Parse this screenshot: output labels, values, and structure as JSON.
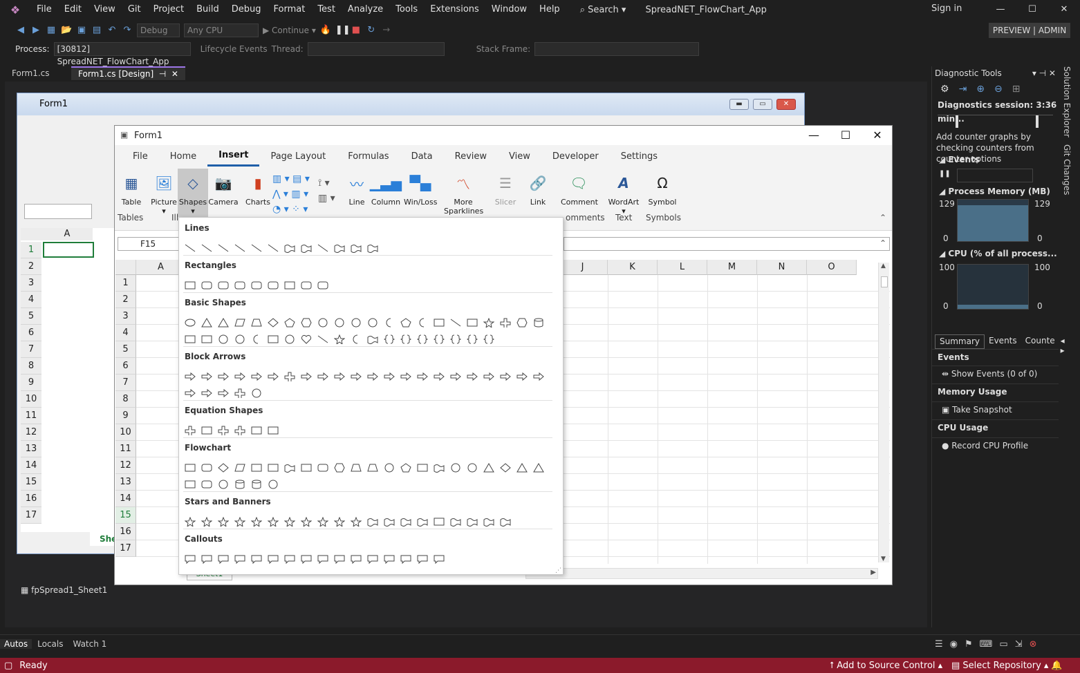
{
  "menubar": {
    "items": [
      "File",
      "Edit",
      "View",
      "Git",
      "Project",
      "Build",
      "Debug",
      "Format",
      "Test",
      "Analyze",
      "Tools",
      "Extensions",
      "Window",
      "Help"
    ],
    "search": "Search",
    "app_title": "SpreadNET_FlowChart_App",
    "sign_in": "Sign in"
  },
  "toolbar": {
    "config": "Debug",
    "platform": "Any CPU",
    "continue": "Continue",
    "preview": "PREVIEW | ADMIN"
  },
  "debugbar": {
    "process_label": "Process:",
    "process_value": "[30812] SpreadNET_FlowChart_App",
    "lifecycle": "Lifecycle Events",
    "thread_label": "Thread:",
    "stack_label": "Stack Frame:"
  },
  "doc_tabs": [
    {
      "label": "Form1.cs"
    },
    {
      "label": "Form1.cs [Design]"
    }
  ],
  "bg_form": {
    "title": "Form1",
    "col_a": "A",
    "rows": [
      "1",
      "2",
      "3",
      "4",
      "5",
      "6",
      "7",
      "8",
      "9",
      "10",
      "11",
      "12",
      "13",
      "14",
      "15",
      "16",
      "17"
    ],
    "sheet_tab": "She"
  },
  "fg_form": {
    "title": "Form1",
    "ribbon_tabs": [
      "File",
      "Home",
      "Insert",
      "Page Layout",
      "Formulas",
      "Data",
      "Review",
      "View",
      "Developer",
      "Settings"
    ],
    "active_tab": "Insert",
    "buttons": {
      "table": "Table",
      "picture": "Picture",
      "shapes": "Shapes",
      "camera": "Camera",
      "charts": "Charts",
      "line": "Line",
      "column": "Column",
      "winloss": "Win/Loss",
      "more": "More",
      "sparklines": "Sparklines",
      "slicer": "Slicer",
      "link": "Link",
      "comment": "Comment",
      "wordart": "WordArt",
      "symbol": "Symbol"
    },
    "groups": {
      "tables": "Tables",
      "ill": "Ill",
      "comments": "omments",
      "text": "Text",
      "symbols": "Symbols"
    },
    "namebox": "F15",
    "columns_left": [
      "A"
    ],
    "columns_right": [
      "J",
      "K",
      "L",
      "M",
      "N",
      "O"
    ],
    "rows": [
      "1",
      "2",
      "3",
      "4",
      "5",
      "6",
      "7",
      "8",
      "9",
      "10",
      "11",
      "12",
      "13",
      "14",
      "15",
      "16",
      "17"
    ],
    "selected_row": "15",
    "sheet_tab": "Sheet1"
  },
  "shapes_gallery": {
    "sections": [
      "Lines",
      "Rectangles",
      "Basic Shapes",
      "Block Arrows",
      "Equation Shapes",
      "Flowchart",
      "Stars and Banners",
      "Callouts"
    ]
  },
  "component_tray": {
    "item": "fpSpread1_Sheet1"
  },
  "diagnostics": {
    "title": "Diagnostic Tools",
    "session": "Diagnostics session: 3:36 min...",
    "hint": "Add counter graphs by checking counters from counter options",
    "events_header": "Events",
    "memory_header": "Process Memory (MB)",
    "mem_max": "129",
    "mem_min": "0",
    "cpu_header": "CPU (% of all process...",
    "cpu_max": "100",
    "cpu_min": "0",
    "tabs": [
      "Summary",
      "Events",
      "Counte"
    ],
    "events_title": "Events",
    "show_events": "Show Events (0 of 0)",
    "memory_usage": "Memory Usage",
    "take_snapshot": "Take Snapshot",
    "cpu_usage": "CPU Usage",
    "record_cpu": "Record CPU Profile"
  },
  "side_tabs": [
    "Solution Explorer",
    "Git Changes"
  ],
  "bottom_tabs": [
    "Autos",
    "Locals",
    "Watch 1"
  ],
  "status": {
    "ready": "Ready",
    "source_control": "Add to Source Control",
    "repository": "Select Repository"
  },
  "colors": {
    "status_bar": "#8b1a2b",
    "accent": "#9d76e8"
  }
}
